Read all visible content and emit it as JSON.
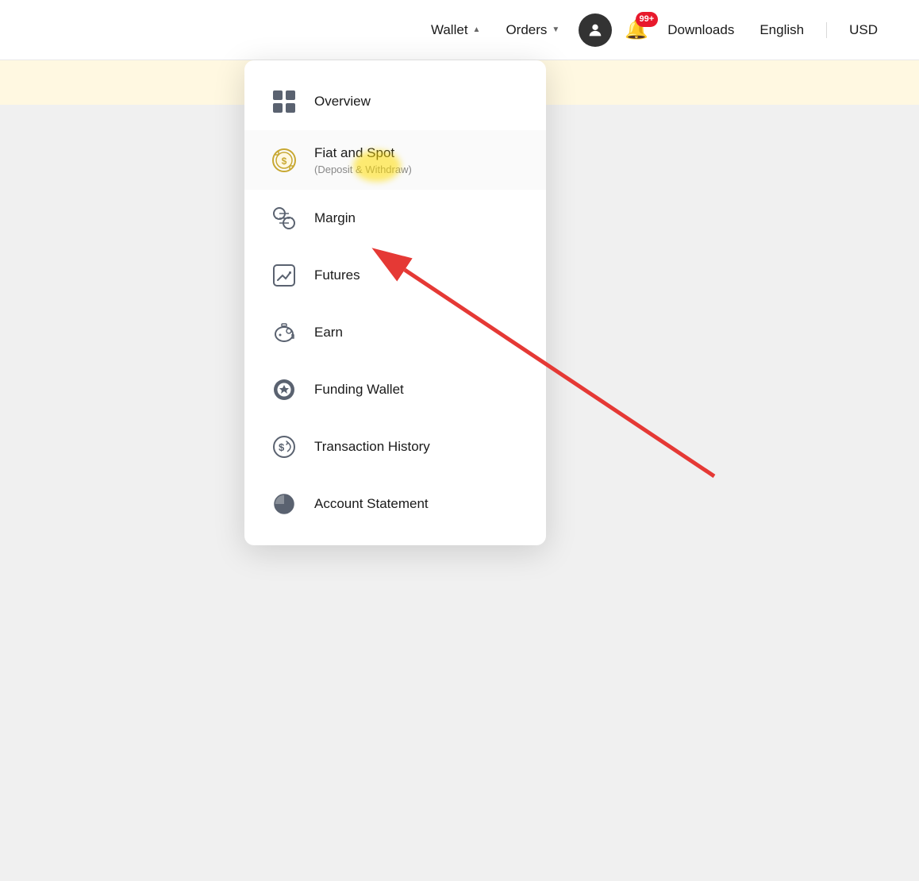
{
  "navbar": {
    "wallet_label": "Wallet",
    "orders_label": "Orders",
    "downloads_label": "Downloads",
    "english_label": "English",
    "usd_label": "USD",
    "badge_count": "99+"
  },
  "menu": {
    "items": [
      {
        "id": "overview",
        "title": "Overview",
        "subtitle": "",
        "icon_type": "grid"
      },
      {
        "id": "fiat-spot",
        "title": "Fiat and Spot",
        "subtitle": "(Deposit & Withdraw)",
        "icon_type": "exchange"
      },
      {
        "id": "margin",
        "title": "Margin",
        "subtitle": "",
        "icon_type": "margin"
      },
      {
        "id": "futures",
        "title": "Futures",
        "subtitle": "",
        "icon_type": "futures"
      },
      {
        "id": "earn",
        "title": "Earn",
        "subtitle": "",
        "icon_type": "earn"
      },
      {
        "id": "funding-wallet",
        "title": "Funding Wallet",
        "subtitle": "",
        "icon_type": "funding"
      },
      {
        "id": "transaction-history",
        "title": "Transaction History",
        "subtitle": "",
        "icon_type": "transaction"
      },
      {
        "id": "account-statement",
        "title": "Account Statement",
        "subtitle": "",
        "icon_type": "statement"
      }
    ]
  }
}
